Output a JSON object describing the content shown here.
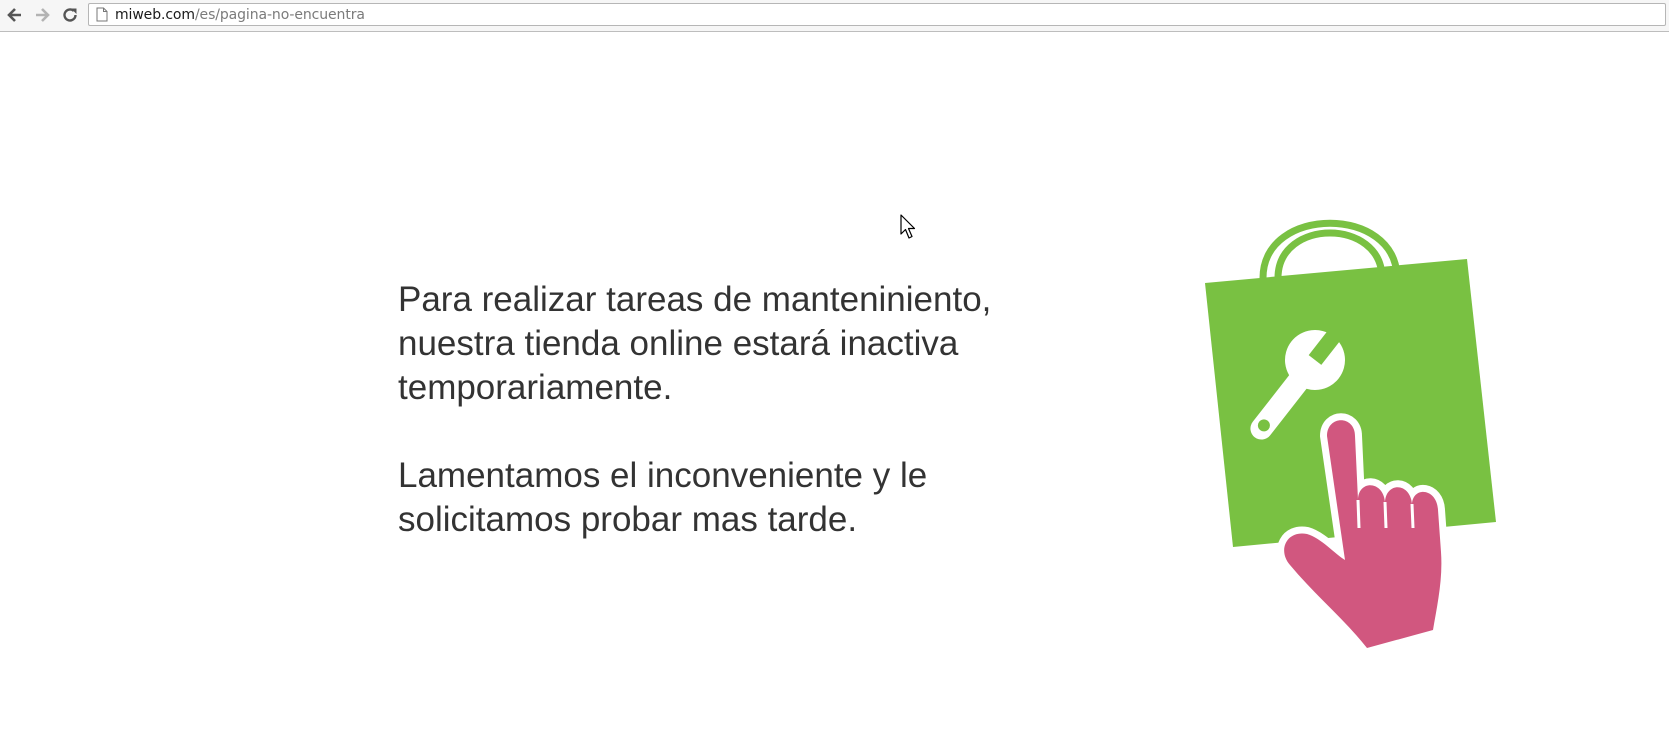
{
  "browser": {
    "url_host": "miweb.com",
    "url_path": "/es/pagina-no-encuentra",
    "back_icon": "arrow-left-icon",
    "forward_icon": "arrow-right-icon",
    "reload_icon": "reload-icon",
    "page_icon": "document-icon"
  },
  "maintenance": {
    "paragraph_1": "Para realizar tareas de manteniniento, nuestra tienda online estará inactiva temporariamente.",
    "paragraph_2": "Lamentamos el inconveniente y le solicitamos probar mas tarde."
  },
  "colors": {
    "bag_green": "#79c142",
    "hand_pink": "#d1577f",
    "text": "#333333"
  }
}
